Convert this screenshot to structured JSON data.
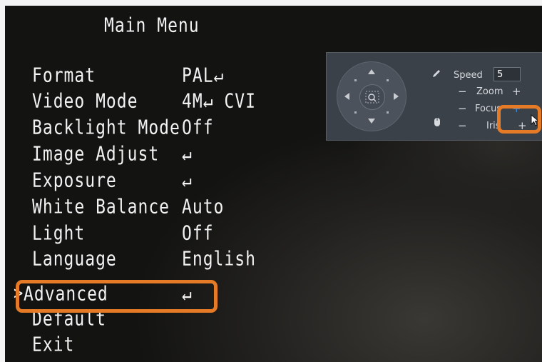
{
  "menu": {
    "title": "Main Menu",
    "cursor": ">",
    "items": [
      {
        "label": "Format",
        "value": "PAL↵"
      },
      {
        "label": "Video Mode",
        "value": "4M↵ CVI"
      },
      {
        "label": "Backlight Mode",
        "value": "Off"
      },
      {
        "label": "Image Adjust",
        "value": "↵"
      },
      {
        "label": "Exposure",
        "value": "↵"
      },
      {
        "label": "White Balance",
        "value": "Auto"
      },
      {
        "label": "Light",
        "value": "Off"
      },
      {
        "label": "Language",
        "value": "English"
      },
      {
        "label": "Advanced",
        "value": "↵"
      },
      {
        "label": "Default",
        "value": ""
      },
      {
        "label": "Exit",
        "value": ""
      }
    ],
    "selected_item": "Advanced"
  },
  "ptz": {
    "speed_label": "Speed",
    "speed_value": "5",
    "zoom_label": "Zoom",
    "focus_label": "Focus",
    "iris_label": "Iris",
    "minus": "−",
    "plus": "+",
    "icons": [
      "pencil-icon",
      "mouse-icon",
      "magnifier-icon",
      "pointer-icon",
      "expand-icon"
    ]
  },
  "colors": {
    "highlight": "#e57a27",
    "focus_plus": "#3d8fe6",
    "osd_text": "#f2f2f2"
  }
}
